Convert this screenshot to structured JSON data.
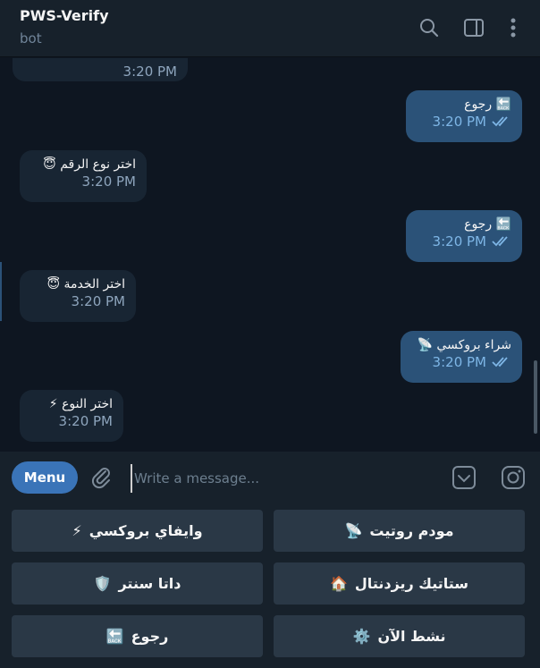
{
  "header": {
    "title": "PWS-Verify",
    "subtitle": "bot"
  },
  "messages": [
    {
      "dir": "in",
      "text": "",
      "time": "3:20 PM"
    },
    {
      "dir": "out",
      "text": "رجوع",
      "emoji": "🔙",
      "time": "3:20 PM"
    },
    {
      "dir": "in",
      "text": "اختر نوع الرقم",
      "emoji": "😇",
      "time": "3:20 PM"
    },
    {
      "dir": "out",
      "text": "رجوع",
      "emoji": "🔙",
      "time": "3:20 PM"
    },
    {
      "dir": "in",
      "text": "اختر الخدمة",
      "emoji": "😇",
      "time": "3:20 PM"
    },
    {
      "dir": "out",
      "text": "شراء بروكسي",
      "emoji": "📡",
      "time": "3:20 PM"
    },
    {
      "dir": "in",
      "text": "اختر النوع",
      "emoji": "⚡",
      "time": "3:20 PM"
    }
  ],
  "composer": {
    "menu_label": "Menu",
    "placeholder": "Write a message..."
  },
  "keyboard": {
    "buttons": [
      {
        "label": "مودم روتيت",
        "emoji": "📡"
      },
      {
        "label": "وايفاي بروكسي",
        "emoji": "⚡"
      },
      {
        "label": "ستاتيك ريزدنتال",
        "emoji": "🏠"
      },
      {
        "label": "داتا سنتر",
        "emoji": "🛡️"
      },
      {
        "label": "نشط الآن",
        "emoji": "⚙️"
      },
      {
        "label": "رجوع",
        "emoji": "🔙"
      }
    ]
  },
  "icons": {
    "search": "search-icon",
    "sidebar": "sidebar-toggle-icon",
    "more": "more-vertical-icon",
    "attach": "paperclip-icon",
    "commands": "bot-commands-icon",
    "instagram": "camera-icon"
  },
  "colors": {
    "background": "#0e1621",
    "header": "#17212b",
    "incoming_bubble": "#182533",
    "outgoing_bubble": "#2b5278",
    "accent": "#3a74b8",
    "keyboard_button": "#2a3846"
  }
}
